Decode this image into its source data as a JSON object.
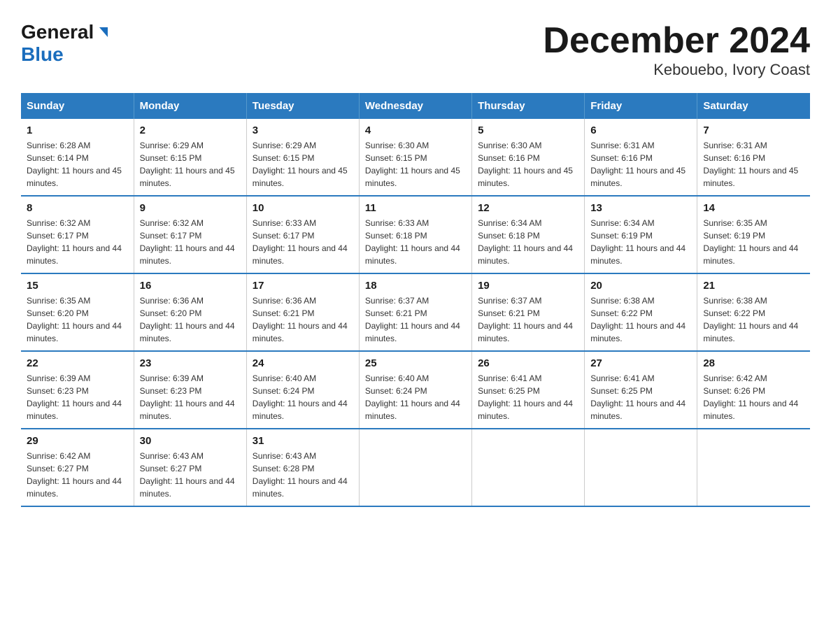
{
  "header": {
    "logo_line1": "General",
    "logo_line2": "Blue",
    "title": "December 2024",
    "subtitle": "Kebouebo, Ivory Coast"
  },
  "calendar": {
    "days_of_week": [
      "Sunday",
      "Monday",
      "Tuesday",
      "Wednesday",
      "Thursday",
      "Friday",
      "Saturday"
    ],
    "weeks": [
      [
        {
          "day": "1",
          "sunrise": "6:28 AM",
          "sunset": "6:14 PM",
          "daylight": "11 hours and 45 minutes."
        },
        {
          "day": "2",
          "sunrise": "6:29 AM",
          "sunset": "6:15 PM",
          "daylight": "11 hours and 45 minutes."
        },
        {
          "day": "3",
          "sunrise": "6:29 AM",
          "sunset": "6:15 PM",
          "daylight": "11 hours and 45 minutes."
        },
        {
          "day": "4",
          "sunrise": "6:30 AM",
          "sunset": "6:15 PM",
          "daylight": "11 hours and 45 minutes."
        },
        {
          "day": "5",
          "sunrise": "6:30 AM",
          "sunset": "6:16 PM",
          "daylight": "11 hours and 45 minutes."
        },
        {
          "day": "6",
          "sunrise": "6:31 AM",
          "sunset": "6:16 PM",
          "daylight": "11 hours and 45 minutes."
        },
        {
          "day": "7",
          "sunrise": "6:31 AM",
          "sunset": "6:16 PM",
          "daylight": "11 hours and 45 minutes."
        }
      ],
      [
        {
          "day": "8",
          "sunrise": "6:32 AM",
          "sunset": "6:17 PM",
          "daylight": "11 hours and 44 minutes."
        },
        {
          "day": "9",
          "sunrise": "6:32 AM",
          "sunset": "6:17 PM",
          "daylight": "11 hours and 44 minutes."
        },
        {
          "day": "10",
          "sunrise": "6:33 AM",
          "sunset": "6:17 PM",
          "daylight": "11 hours and 44 minutes."
        },
        {
          "day": "11",
          "sunrise": "6:33 AM",
          "sunset": "6:18 PM",
          "daylight": "11 hours and 44 minutes."
        },
        {
          "day": "12",
          "sunrise": "6:34 AM",
          "sunset": "6:18 PM",
          "daylight": "11 hours and 44 minutes."
        },
        {
          "day": "13",
          "sunrise": "6:34 AM",
          "sunset": "6:19 PM",
          "daylight": "11 hours and 44 minutes."
        },
        {
          "day": "14",
          "sunrise": "6:35 AM",
          "sunset": "6:19 PM",
          "daylight": "11 hours and 44 minutes."
        }
      ],
      [
        {
          "day": "15",
          "sunrise": "6:35 AM",
          "sunset": "6:20 PM",
          "daylight": "11 hours and 44 minutes."
        },
        {
          "day": "16",
          "sunrise": "6:36 AM",
          "sunset": "6:20 PM",
          "daylight": "11 hours and 44 minutes."
        },
        {
          "day": "17",
          "sunrise": "6:36 AM",
          "sunset": "6:21 PM",
          "daylight": "11 hours and 44 minutes."
        },
        {
          "day": "18",
          "sunrise": "6:37 AM",
          "sunset": "6:21 PM",
          "daylight": "11 hours and 44 minutes."
        },
        {
          "day": "19",
          "sunrise": "6:37 AM",
          "sunset": "6:21 PM",
          "daylight": "11 hours and 44 minutes."
        },
        {
          "day": "20",
          "sunrise": "6:38 AM",
          "sunset": "6:22 PM",
          "daylight": "11 hours and 44 minutes."
        },
        {
          "day": "21",
          "sunrise": "6:38 AM",
          "sunset": "6:22 PM",
          "daylight": "11 hours and 44 minutes."
        }
      ],
      [
        {
          "day": "22",
          "sunrise": "6:39 AM",
          "sunset": "6:23 PM",
          "daylight": "11 hours and 44 minutes."
        },
        {
          "day": "23",
          "sunrise": "6:39 AM",
          "sunset": "6:23 PM",
          "daylight": "11 hours and 44 minutes."
        },
        {
          "day": "24",
          "sunrise": "6:40 AM",
          "sunset": "6:24 PM",
          "daylight": "11 hours and 44 minutes."
        },
        {
          "day": "25",
          "sunrise": "6:40 AM",
          "sunset": "6:24 PM",
          "daylight": "11 hours and 44 minutes."
        },
        {
          "day": "26",
          "sunrise": "6:41 AM",
          "sunset": "6:25 PM",
          "daylight": "11 hours and 44 minutes."
        },
        {
          "day": "27",
          "sunrise": "6:41 AM",
          "sunset": "6:25 PM",
          "daylight": "11 hours and 44 minutes."
        },
        {
          "day": "28",
          "sunrise": "6:42 AM",
          "sunset": "6:26 PM",
          "daylight": "11 hours and 44 minutes."
        }
      ],
      [
        {
          "day": "29",
          "sunrise": "6:42 AM",
          "sunset": "6:27 PM",
          "daylight": "11 hours and 44 minutes."
        },
        {
          "day": "30",
          "sunrise": "6:43 AM",
          "sunset": "6:27 PM",
          "daylight": "11 hours and 44 minutes."
        },
        {
          "day": "31",
          "sunrise": "6:43 AM",
          "sunset": "6:28 PM",
          "daylight": "11 hours and 44 minutes."
        },
        null,
        null,
        null,
        null
      ]
    ]
  }
}
